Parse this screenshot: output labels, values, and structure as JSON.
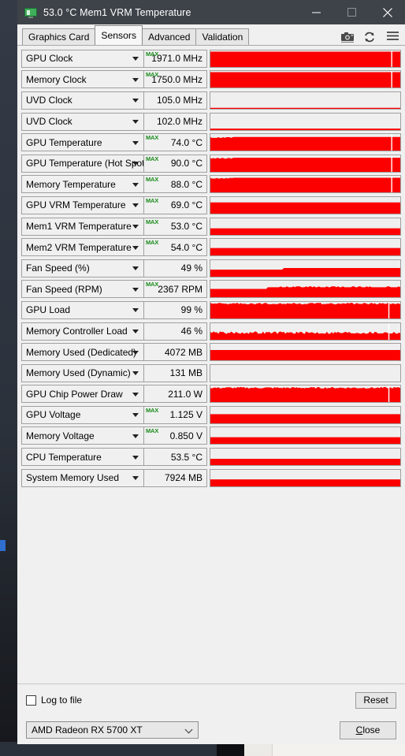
{
  "window": {
    "title": "53.0 °C Mem1 VRM Temperature",
    "app_icon": "gpuz-icon",
    "minimize_label": "Minimize",
    "maximize_label": "Maximize",
    "close_label": "Close"
  },
  "tabs": [
    {
      "label": "Graphics Card",
      "active": false
    },
    {
      "label": "Sensors",
      "active": true
    },
    {
      "label": "Advanced",
      "active": false
    },
    {
      "label": "Validation",
      "active": false
    }
  ],
  "toolbar_icons": [
    {
      "name": "camera-icon"
    },
    {
      "name": "refresh-icon"
    },
    {
      "name": "hamburger-menu-icon"
    }
  ],
  "sensors": [
    {
      "name": "GPU Clock",
      "value": "1971.0 MHz",
      "max": true,
      "graph": "full",
      "level": 0.93
    },
    {
      "name": "Memory Clock",
      "value": "1750.0 MHz",
      "max": true,
      "graph": "full",
      "level": 0.93
    },
    {
      "name": "UVD Clock",
      "value": "105.0 MHz",
      "max": false,
      "graph": "baseline",
      "level": 0.06
    },
    {
      "name": "UVD Clock",
      "value": "102.0 MHz",
      "max": false,
      "graph": "baseline",
      "level": 0.09
    },
    {
      "name": "GPU Temperature",
      "value": "74.0 °C",
      "max": true,
      "graph": "step-high",
      "level": 0.82
    },
    {
      "name": "GPU Temperature (Hot Spot)",
      "value": "90.0 °C",
      "max": true,
      "graph": "step-high",
      "level": 0.85
    },
    {
      "name": "Memory Temperature",
      "value": "88.0 °C",
      "max": true,
      "graph": "step-high",
      "level": 0.88
    },
    {
      "name": "GPU VRM Temperature",
      "value": "69.0 °C",
      "max": true,
      "graph": "mid",
      "level": 0.68
    },
    {
      "name": "Mem1 VRM Temperature",
      "value": "53.0 °C",
      "max": true,
      "graph": "low",
      "level": 0.4
    },
    {
      "name": "Mem2 VRM Temperature",
      "value": "54.0 °C",
      "max": true,
      "graph": "low",
      "level": 0.45
    },
    {
      "name": "Fan Speed (%)",
      "value": "49 %",
      "max": false,
      "graph": "stepped",
      "level": 0.52
    },
    {
      "name": "Fan Speed (RPM)",
      "value": "2367 RPM",
      "max": true,
      "graph": "stepped2",
      "level": 0.6
    },
    {
      "name": "GPU Load",
      "value": "99 %",
      "max": false,
      "graph": "noisy-high",
      "level": 0.9
    },
    {
      "name": "Memory Controller Load",
      "value": "46 %",
      "max": false,
      "graph": "noisy",
      "level": 0.42
    },
    {
      "name": "Memory Used (Dedicated)",
      "value": "4072 MB",
      "max": false,
      "graph": "mid",
      "level": 0.62
    },
    {
      "name": "Memory Used (Dynamic)",
      "value": "131 MB",
      "max": false,
      "graph": "empty",
      "level": 0.0
    },
    {
      "name": "GPU Chip Power Draw",
      "value": "211.0 W",
      "max": false,
      "graph": "noisy-high",
      "level": 0.86
    },
    {
      "name": "GPU Voltage",
      "value": "1.125 V",
      "max": true,
      "graph": "mid",
      "level": 0.55
    },
    {
      "name": "Memory Voltage",
      "value": "0.850 V",
      "max": true,
      "graph": "low",
      "level": 0.4
    },
    {
      "name": "CPU Temperature",
      "value": "53.5 °C",
      "max": false,
      "graph": "low",
      "level": 0.38
    },
    {
      "name": "System Memory Used",
      "value": "7924 MB",
      "max": false,
      "graph": "low",
      "level": 0.42
    }
  ],
  "controls": {
    "log_to_file_label": "Log to file",
    "log_to_file_checked": false,
    "reset_label": "Reset",
    "gpu_selected": "AMD Radeon RX 5700 XT",
    "close_label": "Close"
  },
  "colors": {
    "graph_fill": "#fc0000",
    "titlebar": "#3d4349",
    "max_tag": "#1a8c1a",
    "window_bg": "#f0f0f0"
  }
}
